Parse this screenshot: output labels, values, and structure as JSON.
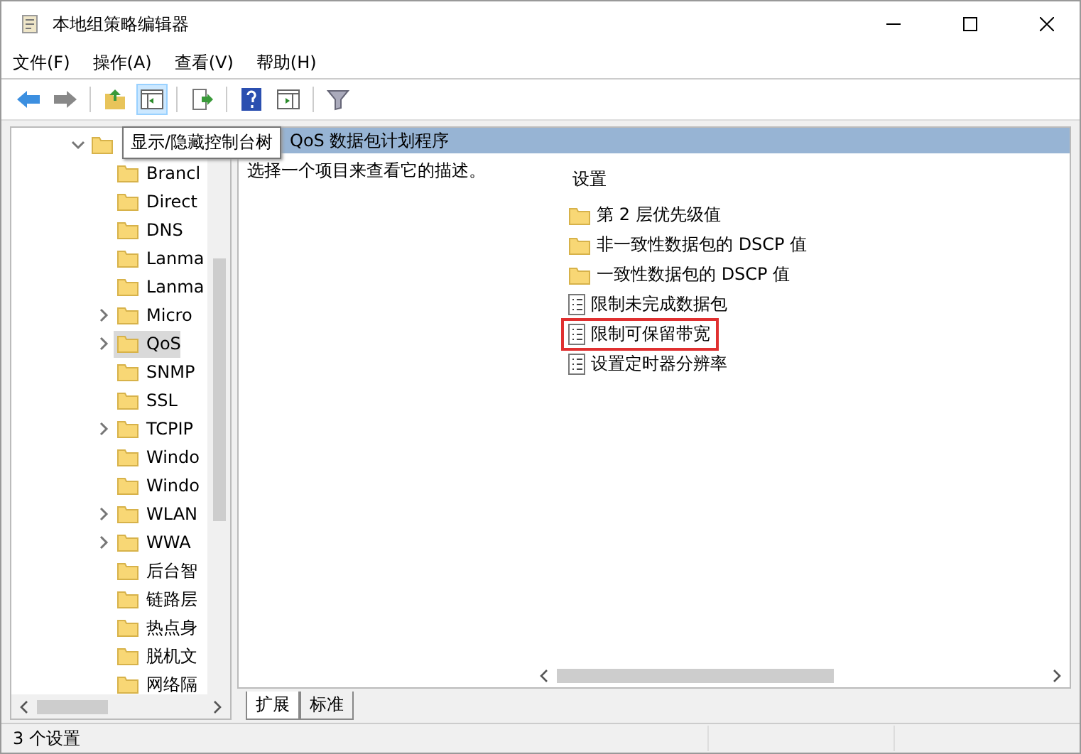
{
  "window": {
    "title": "本地组策略编辑器"
  },
  "menu": [
    "文件(F)",
    "操作(A)",
    "查看(V)",
    "帮助(H)"
  ],
  "tooltip": "显示/隐藏控制台树",
  "tree": {
    "expanded": true,
    "children": [
      {
        "label": "Brancl",
        "expandable": false,
        "selected": false
      },
      {
        "label": "Direct",
        "expandable": false,
        "selected": false
      },
      {
        "label": "DNS",
        "expandable": false,
        "selected": false
      },
      {
        "label": "Lanma",
        "expandable": false,
        "selected": false
      },
      {
        "label": "Lanma",
        "expandable": false,
        "selected": false
      },
      {
        "label": "Micro",
        "expandable": true,
        "selected": false
      },
      {
        "label": "QoS",
        "expandable": true,
        "selected": true
      },
      {
        "label": "SNMP",
        "expandable": false,
        "selected": false
      },
      {
        "label": "SSL",
        "expandable": false,
        "selected": false
      },
      {
        "label": "TCPIP",
        "expandable": true,
        "selected": false
      },
      {
        "label": "Windo",
        "expandable": false,
        "selected": false
      },
      {
        "label": "Windo",
        "expandable": false,
        "selected": false
      },
      {
        "label": "WLAN",
        "expandable": true,
        "selected": false
      },
      {
        "label": "WWA",
        "expandable": true,
        "selected": false
      },
      {
        "label": "后台智",
        "expandable": false,
        "selected": false
      },
      {
        "label": "链路层",
        "expandable": false,
        "selected": false
      },
      {
        "label": "热点身",
        "expandable": false,
        "selected": false
      },
      {
        "label": "脱机文",
        "expandable": false,
        "selected": false
      },
      {
        "label": "网络隔",
        "expandable": false,
        "selected": false
      }
    ]
  },
  "content": {
    "header": "QoS 数据包计划程序",
    "description": "选择一个项目来查看它的描述。",
    "column": "设置",
    "items": [
      {
        "kind": "folder",
        "label": "第 2 层优先级值",
        "highlighted": false
      },
      {
        "kind": "folder",
        "label": "非一致性数据包的 DSCP 值",
        "highlighted": false
      },
      {
        "kind": "folder",
        "label": "一致性数据包的 DSCP 值",
        "highlighted": false
      },
      {
        "kind": "policy",
        "label": "限制未完成数据包",
        "highlighted": false
      },
      {
        "kind": "policy",
        "label": "限制可保留带宽",
        "highlighted": true
      },
      {
        "kind": "policy",
        "label": "设置定时器分辨率",
        "highlighted": false
      }
    ]
  },
  "tabs": [
    {
      "label": "扩展",
      "selected": true
    },
    {
      "label": "标准",
      "selected": false
    }
  ],
  "status_bar": "3 个设置"
}
